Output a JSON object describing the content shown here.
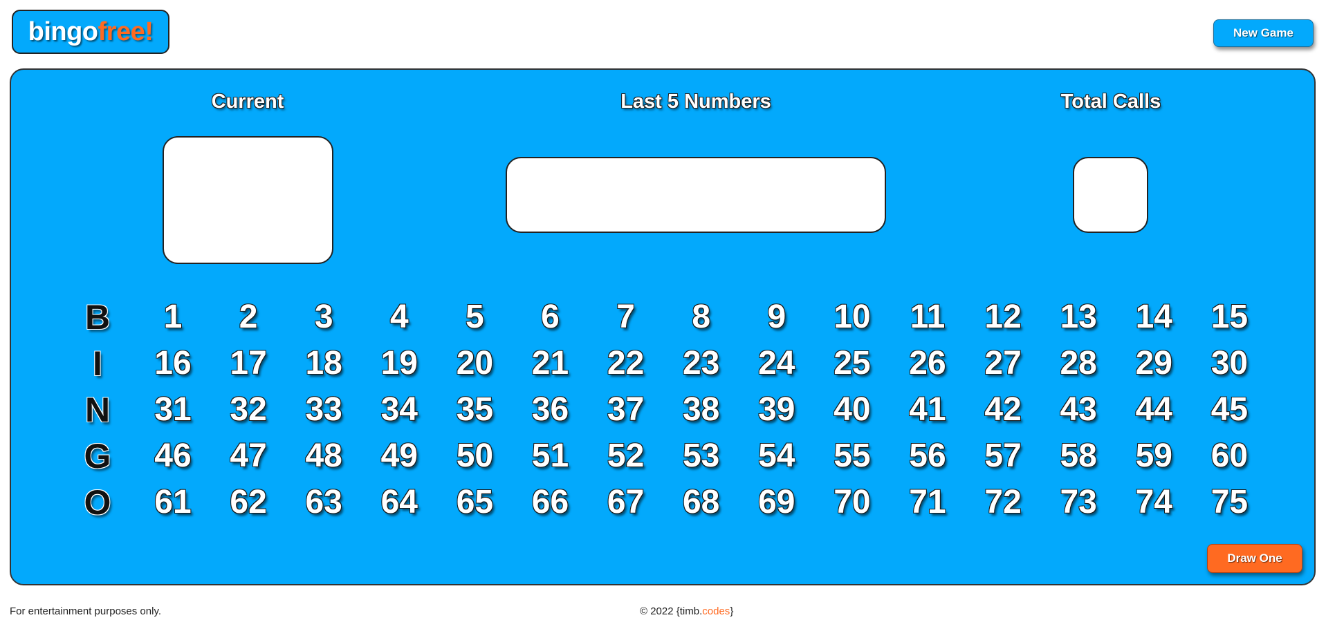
{
  "header": {
    "logo_part1": "bingo",
    "logo_part2": "free!",
    "new_game_label": "New Game"
  },
  "board": {
    "current_title": "Current",
    "last_title": "Last 5 Numbers",
    "total_title": "Total Calls",
    "current_value": "",
    "last_value": "",
    "total_value": "",
    "letters": [
      "B",
      "I",
      "N",
      "G",
      "O"
    ],
    "rows": [
      [
        "1",
        "2",
        "3",
        "4",
        "5",
        "6",
        "7",
        "8",
        "9",
        "10",
        "11",
        "12",
        "13",
        "14",
        "15"
      ],
      [
        "16",
        "17",
        "18",
        "19",
        "20",
        "21",
        "22",
        "23",
        "24",
        "25",
        "26",
        "27",
        "28",
        "29",
        "30"
      ],
      [
        "31",
        "32",
        "33",
        "34",
        "35",
        "36",
        "37",
        "38",
        "39",
        "40",
        "41",
        "42",
        "43",
        "44",
        "45"
      ],
      [
        "46",
        "47",
        "48",
        "49",
        "50",
        "51",
        "52",
        "53",
        "54",
        "55",
        "56",
        "57",
        "58",
        "59",
        "60"
      ],
      [
        "61",
        "62",
        "63",
        "64",
        "65",
        "66",
        "67",
        "68",
        "69",
        "70",
        "71",
        "72",
        "73",
        "74",
        "75"
      ]
    ],
    "draw_label": "Draw One"
  },
  "footer": {
    "disclaimer": "For entertainment purposes only.",
    "copyright_prefix": "© 2022 {timb.",
    "copyright_accent": "codes",
    "copyright_suffix": "}"
  },
  "colors": {
    "board_blue": "#03a9fc",
    "accent_orange": "#ff6a21"
  }
}
